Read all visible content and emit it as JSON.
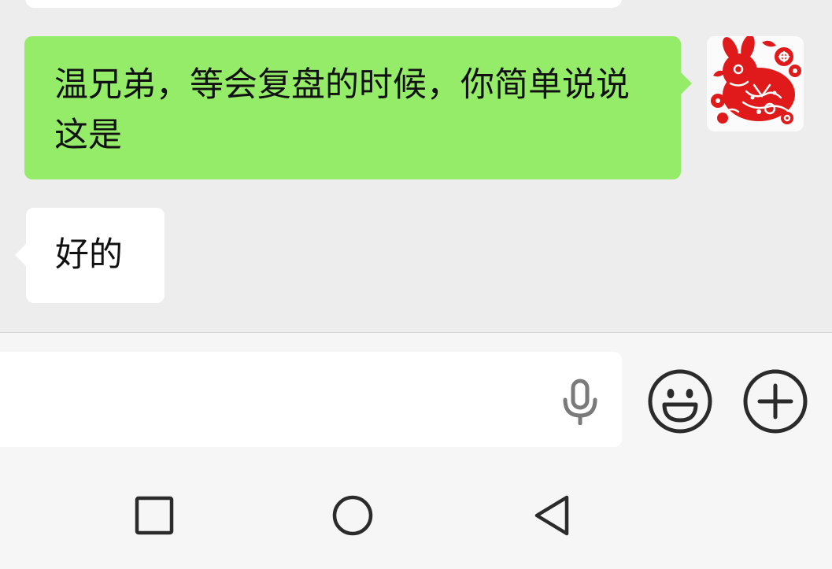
{
  "chat": {
    "messages": [
      {
        "direction": "sent",
        "text": "温兄弟，等会复盘的时候，你简单说说这是"
      },
      {
        "direction": "received",
        "text": "好的"
      }
    ],
    "avatar": {
      "icon": "paper-cut-rabbit-avatar",
      "color": "#e01a1a"
    }
  },
  "composer": {
    "input_value": "",
    "mic_icon": "microphone-icon",
    "emoji_icon": "smiley-face-icon",
    "plus_icon": "plus-circle-icon"
  },
  "navbar": {
    "recents_icon": "square-icon",
    "home_icon": "circle-icon",
    "back_icon": "triangle-back-icon"
  },
  "colors": {
    "chat_background": "#ededed",
    "sent_bubble": "#95ec69",
    "received_bubble": "#ffffff",
    "icon": "#2b2b2b"
  }
}
